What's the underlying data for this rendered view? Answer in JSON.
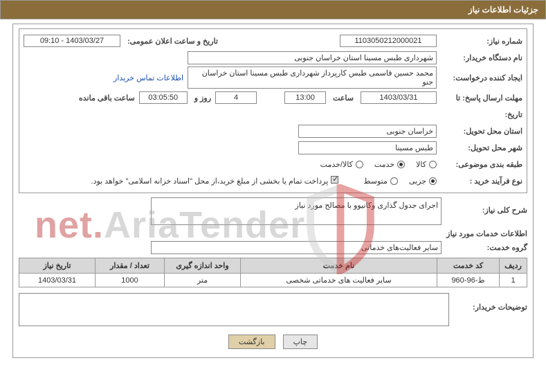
{
  "header_title": "جزئیات اطلاعات نیاز",
  "labels": {
    "need_no": "شماره نیاز:",
    "announce_dt": "تاریخ و ساعت اعلان عمومی:",
    "buyer_org": "نام دستگاه خریدار:",
    "creator": "ایجاد کننده درخواست:",
    "contact_link": "اطلاعات تماس خریدار",
    "deadline": "مهلت ارسال پاسخ: تا",
    "time_label": "ساعت",
    "days_and": "روز و",
    "remaining": "ساعت باقی مانده",
    "date_label": "تاریخ:",
    "delivery_province": "استان محل تحویل:",
    "delivery_city": "شهر محل تحویل:",
    "subject_class": "طبقه بندی موضوعی:",
    "opt_goods": "کالا",
    "opt_service": "خدمت",
    "opt_goods_service": "کالا/خدمت",
    "purchase_type": "نوع فرآیند خرید :",
    "opt_small": "جزیی",
    "opt_medium": "متوسط",
    "payment_note": "پرداخت تمام یا بخشی از مبلغ خرید،از محل \"اسناد خزانه اسلامی\" خواهد بود.",
    "need_desc": "شرح کلی نیاز:",
    "services_info": "اطلاعات خدمات مورد نیاز",
    "service_group": "گروه خدمت:",
    "buyer_notes": "توضیحات خریدار:"
  },
  "fields": {
    "need_no": "1103050212000021",
    "announce_dt": "1403/03/27 - 09:10",
    "buyer_org": "شهرداری طبس مسینا استان خراسان جنوبی",
    "creator": "محمد حسین قاسمی طبس کارپرداز شهرداری طبس مسینا استان خراسان جنو",
    "deadline_date": "1403/03/31",
    "deadline_time": "13:00",
    "days": "4",
    "hours_left": "03:05:50",
    "delivery_province": "خراسان جنوبی",
    "delivery_city": "طبس مسینا",
    "need_desc": "اجرای جدول گذاری وکانیوو با مصالح مورد نیاز",
    "service_group": "سایر فعالیت‌های خدماتی"
  },
  "table": {
    "headers": {
      "row": "ردیف",
      "service_code": "کد خدمت",
      "service_name": "نام خدمت",
      "unit": "واحد اندازه گیری",
      "qty": "تعداد / مقدار",
      "need_date": "تاریخ نیاز"
    },
    "rows": [
      {
        "row": "1",
        "code": "ط-96-960",
        "name": "سایر فعالیت های خدماتی شخصی",
        "unit": "متر",
        "qty": "1000",
        "date": "1403/03/31"
      }
    ]
  },
  "buttons": {
    "print": "چاپ",
    "back": "بازگشت"
  },
  "watermark": {
    "p1": "AriaTender",
    "p2": ".net"
  }
}
